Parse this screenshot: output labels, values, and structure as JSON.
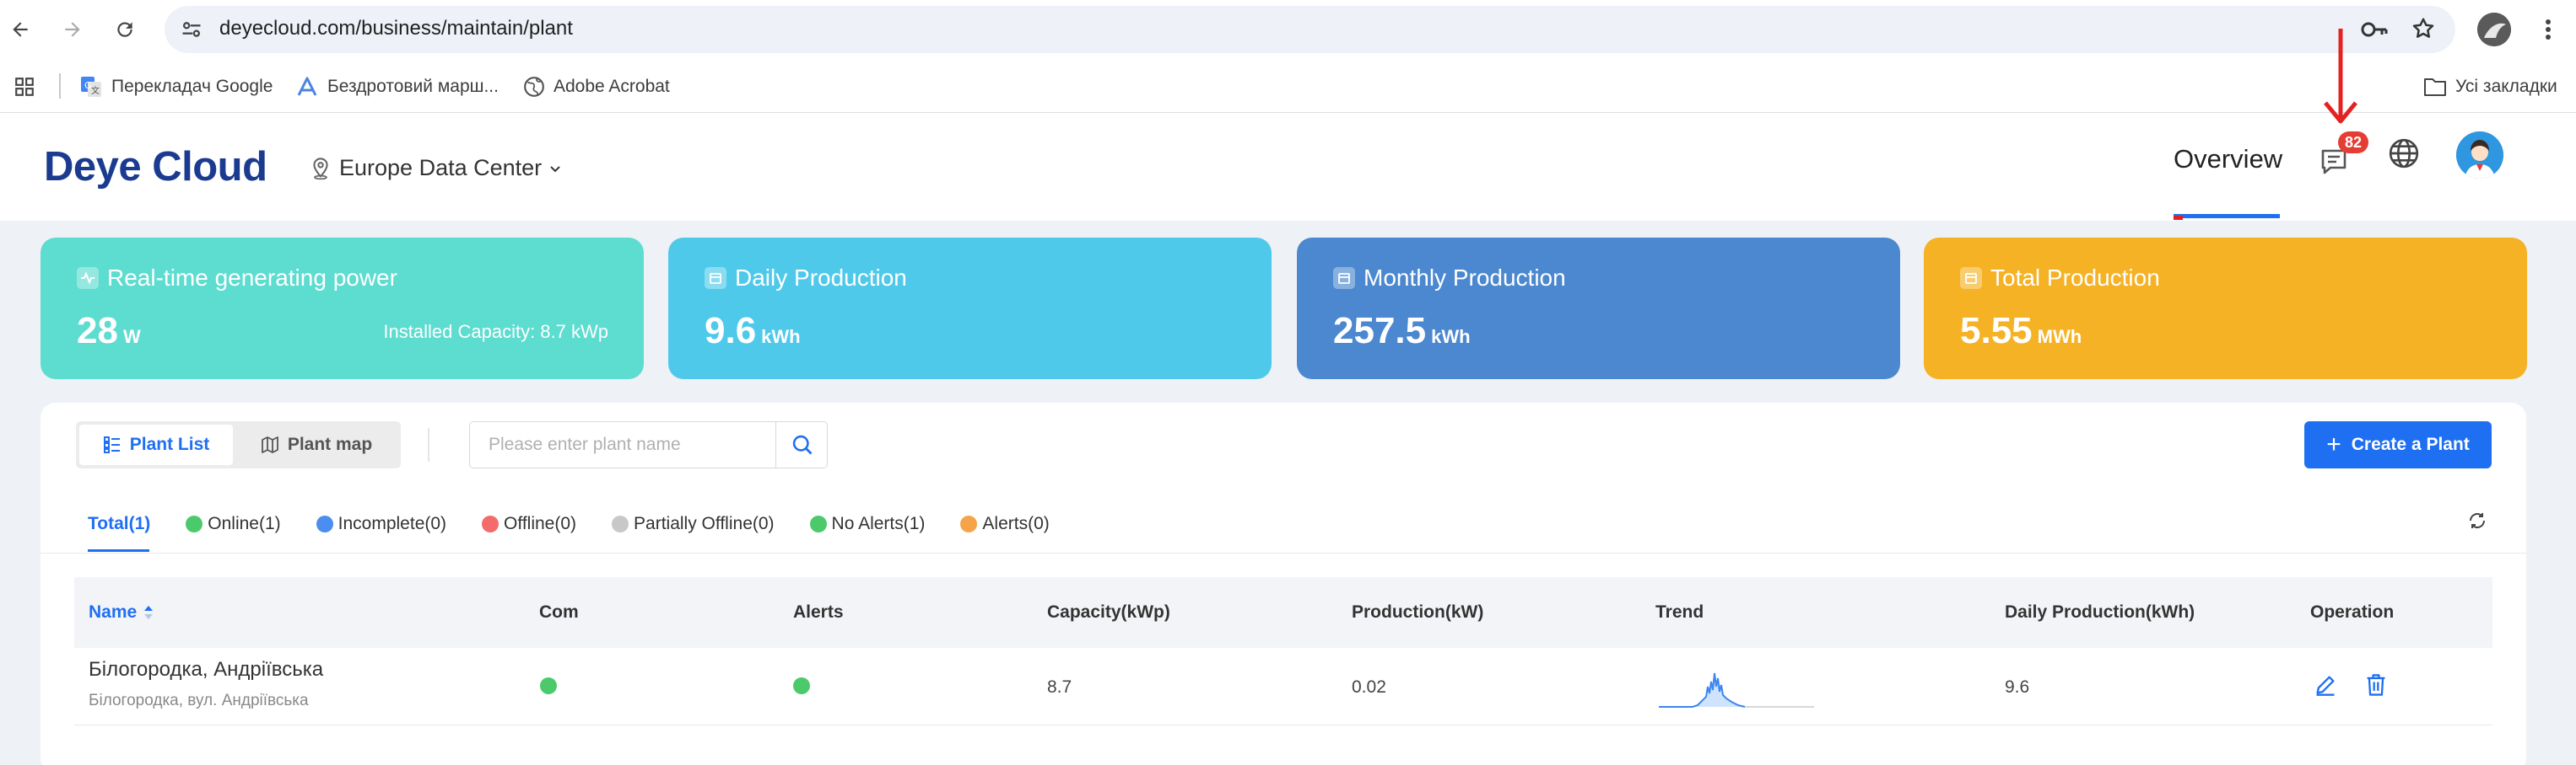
{
  "browser": {
    "url": "deyecloud.com/business/maintain/plant",
    "bookmarks": [
      {
        "label": "Перекладач Google",
        "icon": "google-translate-icon"
      },
      {
        "label": "Бездротовий марш...",
        "icon": "router-icon"
      },
      {
        "label": "Adobe Acrobat",
        "icon": "globe-icon"
      }
    ],
    "all_bookmarks_label": "Усі закладки"
  },
  "header": {
    "logo": "Deye Cloud",
    "data_center": "Europe Data Center",
    "nav_overview": "Overview",
    "message_badge": "82"
  },
  "cards": [
    {
      "title": "Real-time generating power",
      "value": "28",
      "unit": "W",
      "extra": "Installed Capacity: 8.7 kWp",
      "color": "#5ddcd0"
    },
    {
      "title": "Daily Production",
      "value": "9.6",
      "unit": "kWh",
      "color": "#4fc9ea"
    },
    {
      "title": "Monthly Production",
      "value": "257.5",
      "unit": "kWh",
      "color": "#4b88cf"
    },
    {
      "title": "Total Production",
      "value": "5.55",
      "unit": "MWh",
      "color": "#f5b224"
    }
  ],
  "toolbar": {
    "plant_list": "Plant List",
    "plant_map": "Plant map",
    "search_placeholder": "Please enter plant name",
    "create_plant": "Create a Plant"
  },
  "filters": [
    {
      "label": "Total(1)",
      "active": true
    },
    {
      "label": "Online(1)",
      "color": "#4cca6b"
    },
    {
      "label": "Incomplete(0)",
      "color": "#4b8ef0"
    },
    {
      "label": "Offline(0)",
      "color": "#f46b6b"
    },
    {
      "label": "Partially Offline(0)",
      "color": "#c8c8c8"
    },
    {
      "label": "No Alerts(1)",
      "color": "#4cca6b"
    },
    {
      "label": "Alerts(0)",
      "color": "#f5a44a"
    }
  ],
  "table": {
    "columns": [
      "Name",
      "Com",
      "Alerts",
      "Capacity(kWp)",
      "Production(kW)",
      "Trend",
      "Daily Production(kWh)",
      "Operation"
    ],
    "rows": [
      {
        "name": "Білогородка, Андріївська",
        "address": "Білогородка, вул. Андріївська",
        "com_status": "online",
        "alert_status": "no-alerts",
        "capacity": "8.7",
        "production": "0.02",
        "daily_production": "9.6"
      }
    ]
  },
  "colors": {
    "primary": "#1f6ff2",
    "status_green": "#4cca6b",
    "badge_red": "#e43d33"
  }
}
